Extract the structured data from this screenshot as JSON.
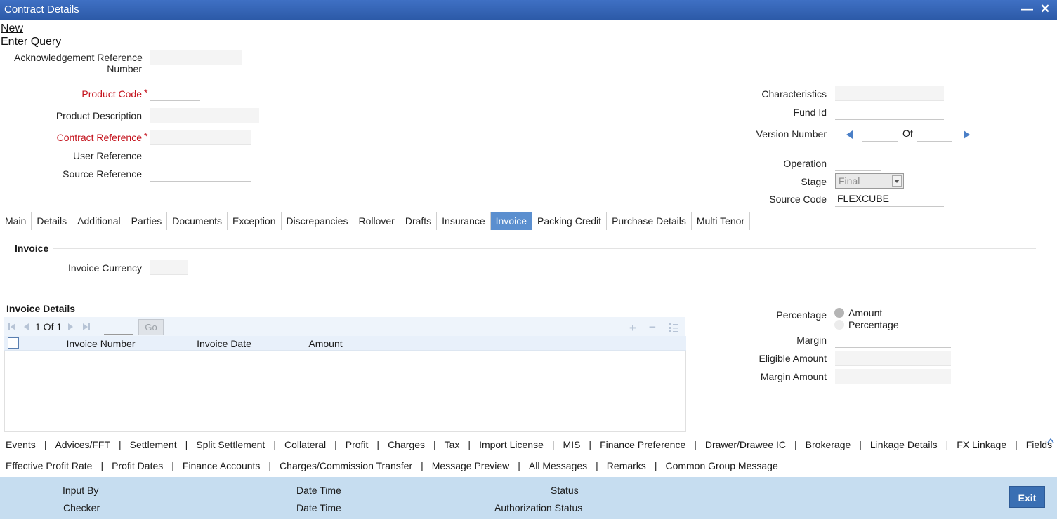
{
  "window": {
    "title": "Contract Details",
    "minimize_glyph": "—",
    "close_glyph": "✕"
  },
  "actions": {
    "new": "New",
    "enter_query": "Enter Query"
  },
  "fields": {
    "ack_ref_line1": "Acknowledgement Reference",
    "ack_ref_line2": "Number",
    "product_code": "Product Code",
    "product_description": "Product Description",
    "contract_reference": "Contract Reference",
    "user_reference": "User Reference",
    "source_reference": "Source Reference",
    "required_mark": "*",
    "characteristics": "Characteristics",
    "fund_id": "Fund Id",
    "version_number": "Version Number",
    "version_of": "Of",
    "operation": "Operation",
    "stage": "Stage",
    "stage_value": "Final",
    "source_code": "Source Code",
    "source_code_value": "FLEXCUBE"
  },
  "tabs": [
    "Main",
    "Details",
    "Additional",
    "Parties",
    "Documents",
    "Exception",
    "Discrepancies",
    "Rollover",
    "Drafts",
    "Insurance",
    "Invoice",
    "Packing Credit",
    "Purchase Details",
    "Multi Tenor"
  ],
  "active_tab": "Invoice",
  "invoice": {
    "section_title": "Invoice",
    "currency_label": "Invoice Currency",
    "details_title": "Invoice Details",
    "pager_text": "1 Of 1",
    "go_label": "Go",
    "columns": [
      "Invoice Number",
      "Invoice Date",
      "Amount"
    ],
    "percentage_label": "Percentage",
    "radio_amount": "Amount",
    "radio_percentage": "Percentage",
    "margin": "Margin",
    "eligible_amount": "Eligible Amount",
    "margin_amount": "Margin Amount"
  },
  "footer_links_row1": [
    "Events",
    "Advices/FFT",
    "Settlement",
    "Split Settlement",
    "Collateral",
    "Profit",
    "Charges",
    "Tax",
    "Import License",
    "MIS",
    "Finance Preference",
    "Drawer/Drawee IC",
    "Brokerage",
    "Linkage Details",
    "FX Linkage",
    "Fields"
  ],
  "footer_links_row2": [
    "Effective Profit Rate",
    "Profit Dates",
    "Finance Accounts",
    "Charges/Commission Transfer",
    "Message Preview",
    "All Messages",
    "Remarks",
    "Common Group Message"
  ],
  "status": {
    "input_by": "Input By",
    "date_time_1": "Date Time",
    "status": "Status",
    "checker": "Checker",
    "date_time_2": "Date Time",
    "authorization_status": "Authorization Status",
    "exit": "Exit"
  },
  "colors": {
    "titlebar": "#3f70c4",
    "active_tab": "#5b8fcf",
    "status_bar": "#c6ddf0",
    "required": "#c4121c",
    "exit_button": "#3a6fb3"
  }
}
